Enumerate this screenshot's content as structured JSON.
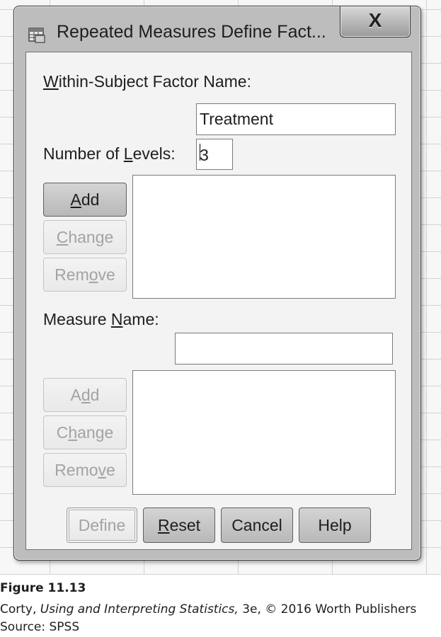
{
  "window": {
    "title": "Repeated Measures Define Fact...",
    "icon": "spreadsheet-dialog-icon",
    "close_label": "X"
  },
  "factor_section": {
    "label_prefix": "W",
    "label_rest": "ithin-Subject Factor Name:",
    "factor_name_value": "Treatment",
    "levels_label_prefix": "Number of ",
    "levels_label_mnemonic": "L",
    "levels_label_rest": "evels:",
    "levels_value": "3"
  },
  "factor_buttons": {
    "add": {
      "mnemonic": "A",
      "rest": "dd"
    },
    "change": {
      "mnemonic": "C",
      "rest": "hange"
    },
    "remove_pre": "Rem",
    "remove_mnemonic": "o",
    "remove_rest": "ve"
  },
  "measure_section": {
    "label_prefix": "Measure ",
    "label_mnemonic": "N",
    "label_rest": "ame:",
    "measure_name_value": ""
  },
  "measure_buttons": {
    "add_pre": "A",
    "add_mnemonic": "d",
    "add_rest": "d",
    "change_pre": "C",
    "change_mnemonic": "h",
    "change_rest": "ange",
    "remove_pre": "Remo",
    "remove_mnemonic": "v",
    "remove_rest": "e"
  },
  "bottom_buttons": {
    "define": "Define",
    "reset_mnemonic": "R",
    "reset_rest": "eset",
    "cancel": "Cancel",
    "help": "Help"
  },
  "caption": {
    "figure": "Figure 11.13",
    "author": "Corty, ",
    "book_title": "Using and Interpreting Statistics,",
    "edition": " 3e, © 2016 Worth Publishers",
    "source": "Source: SPSS"
  },
  "colors": {
    "frame": "#bdbdbd",
    "client": "#f3f3f3",
    "disabled_text": "#a3a3a3"
  }
}
